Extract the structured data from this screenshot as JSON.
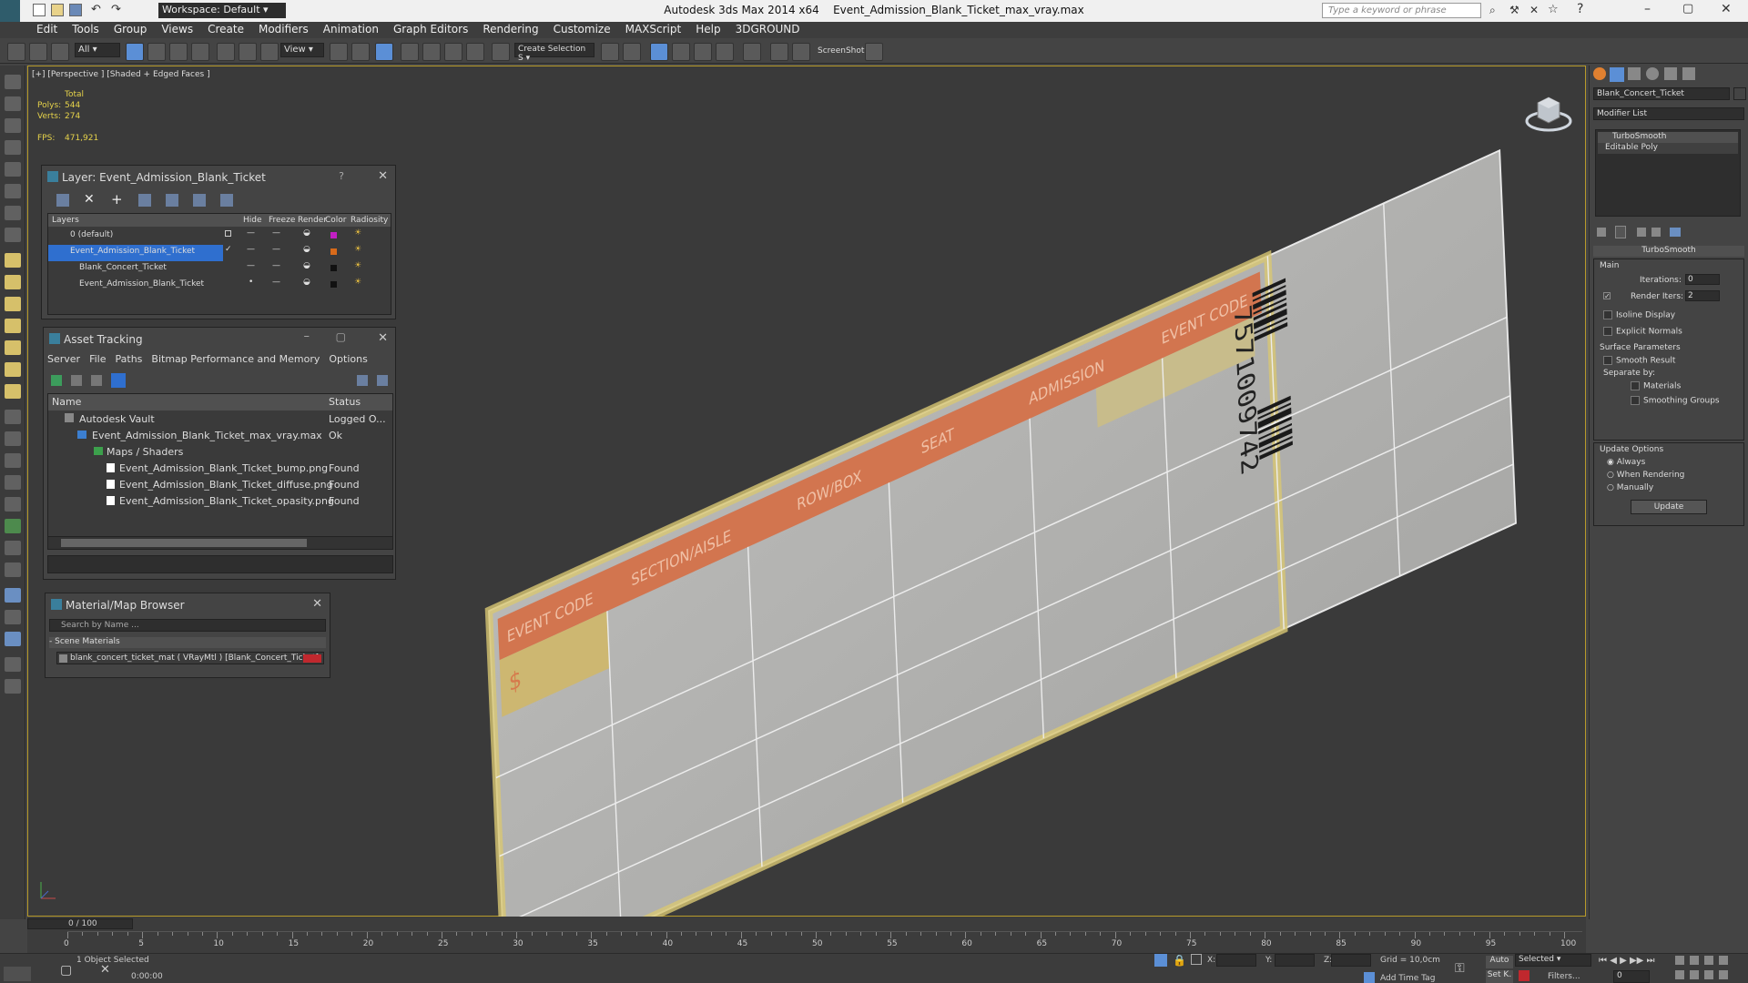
{
  "title_bar": {
    "app_title": "Autodesk 3ds Max  2014 x64",
    "file_name": "Event_Admission_Blank_Ticket_max_vray.max",
    "workspace": "Workspace: Default",
    "search_placeholder": "Type a keyword or phrase"
  },
  "menu": [
    "Edit",
    "Tools",
    "Group",
    "Views",
    "Create",
    "Modifiers",
    "Animation",
    "Graph Editors",
    "Rendering",
    "Customize",
    "MAXScript",
    "Help",
    "3DGROUND"
  ],
  "toolbar": {
    "filter_value": "All",
    "view_value": "View",
    "selection_set": "Create Selection S",
    "screenshot_label": "ScreenShot"
  },
  "viewport": {
    "label": "[+] [Perspective ] [Shaded + Edged Faces ]",
    "stats_total": "Total",
    "polys_label": "Polys:",
    "polys_value": "544",
    "verts_label": "Verts:",
    "verts_value": "274",
    "fps_label": "FPS:",
    "fps_value": "471,921"
  },
  "ticket": {
    "event_code": "EVENT CODE",
    "section_aisle": "SECTION/AISLE",
    "row_box": "ROW/BOX",
    "seat": "SEAT",
    "admission": "ADMISSION",
    "event_code_2": "EVENT CODE",
    "barcode_number": "7571009742"
  },
  "layer_panel": {
    "title": "Layer: Event_Admission_Blank_Ticket",
    "help": "?",
    "columns": [
      "Layers",
      "Hide",
      "Freeze",
      "Render",
      "Color",
      "Radiosity"
    ],
    "rows": [
      {
        "name": "0 (default)",
        "color": "#c21fc4"
      },
      {
        "name": "Event_Admission_Blank_Ticket",
        "color": "#d86a1a"
      },
      {
        "name": "Blank_Concert_Ticket",
        "color": "#111111"
      },
      {
        "name": "Event_Admission_Blank_Ticket",
        "color": "#111111"
      }
    ]
  },
  "asset_panel": {
    "title": "Asset Tracking",
    "menu": [
      "Server",
      "File",
      "Paths",
      "Bitmap Performance and Memory",
      "Options"
    ],
    "col_name": "Name",
    "col_status": "Status",
    "rows": [
      {
        "name": "Autodesk Vault",
        "status": "Logged O...",
        "indent": 1
      },
      {
        "name": "Event_Admission_Blank_Ticket_max_vray.max",
        "status": "Ok",
        "indent": 2
      },
      {
        "name": "Maps / Shaders",
        "status": "",
        "indent": 3
      },
      {
        "name": "Event_Admission_Blank_Ticket_bump.png",
        "status": "Found",
        "indent": 4
      },
      {
        "name": "Event_Admission_Blank_Ticket_diffuse.png",
        "status": "Found",
        "indent": 4
      },
      {
        "name": "Event_Admission_Blank_Ticket_opasity.png",
        "status": "Found",
        "indent": 4
      }
    ]
  },
  "material_panel": {
    "title": "Material/Map Browser",
    "search_placeholder": "Search by Name ...",
    "section": "- Scene Materials",
    "item": "blank_concert_ticket_mat  ( VRayMtl )  [Blank_Concert_Ticket]"
  },
  "right_panel": {
    "object_name": "Blank_Concert_Ticket",
    "modifier_list": "Modifier List",
    "stack": [
      "TurboSmooth",
      "Editable Poly"
    ],
    "rollout_title": "TurboSmooth",
    "main_label": "Main",
    "iterations_label": "Iterations:",
    "iterations_value": "0",
    "render_iters_label": "Render Iters:",
    "render_iters_value": "2",
    "isoline": "Isoline Display",
    "explicit": "Explicit Normals",
    "surface_params": "Surface Parameters",
    "smooth_result": "Smooth Result",
    "separate_by": "Separate by:",
    "materials": "Materials",
    "smoothing_groups": "Smoothing Groups",
    "update_options": "Update Options",
    "always": "Always",
    "when_rendering": "When Rendering",
    "manually": "Manually",
    "update_button": "Update"
  },
  "timeline": {
    "frame_counter": "0 / 100",
    "ticks": [
      "0",
      "5",
      "10",
      "15",
      "20",
      "25",
      "30",
      "35",
      "40",
      "45",
      "50",
      "55",
      "60",
      "65",
      "70",
      "75",
      "80",
      "85",
      "90",
      "95",
      "100"
    ]
  },
  "statusbar": {
    "selected": "1 Object Selected",
    "time": "0:00:00",
    "x_label": "X:",
    "y_label": "Y:",
    "z_label": "Z:",
    "grid": "Grid = 10,0cm",
    "add_time_tag": "Add Time Tag",
    "auto": "Auto",
    "selected_dropdown": "Selected",
    "set_k": "Set K.",
    "filters": "Filters...",
    "frame": "0"
  }
}
